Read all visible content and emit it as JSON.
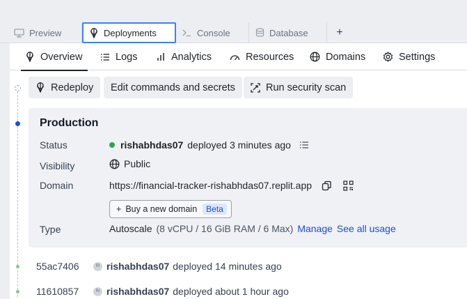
{
  "tabs": [
    {
      "label": "Preview",
      "icon": "monitor-icon",
      "active": false
    },
    {
      "label": "Deployments",
      "icon": "deployments-icon",
      "active": true
    },
    {
      "label": "Console",
      "icon": "terminal-icon",
      "active": false
    },
    {
      "label": "Database",
      "icon": "database-icon",
      "active": false
    }
  ],
  "add_tab_label": "+",
  "subnav": [
    {
      "label": "Overview",
      "icon": "deployments-icon",
      "active": true
    },
    {
      "label": "Logs",
      "icon": "list-icon"
    },
    {
      "label": "Analytics",
      "icon": "bar-chart-icon"
    },
    {
      "label": "Resources",
      "icon": "gauge-icon"
    },
    {
      "label": "Domains",
      "icon": "globe-icon"
    },
    {
      "label": "Settings",
      "icon": "gear-icon"
    }
  ],
  "actions": {
    "redeploy": "Redeploy",
    "edit_commands": "Edit commands and secrets",
    "security_scan": "Run security scan"
  },
  "production": {
    "title": "Production",
    "status_label": "Status",
    "status_user": "rishabhdas07",
    "status_text": "deployed 3 minutes ago",
    "visibility_label": "Visibility",
    "visibility_value": "Public",
    "domain_label": "Domain",
    "domain_url": "https://financial-tracker-rishabhdas07.replit.app",
    "buy_domain": "Buy a new domain",
    "buy_domain_plus": "+",
    "beta_badge": "Beta",
    "type_label": "Type",
    "type_value": "Autoscale",
    "type_specs": "(8 vCPU / 16 GiB RAM / 6 Max)",
    "manage_link": "Manage",
    "usage_link": "See all usage"
  },
  "history": [
    {
      "hash": "55ac7406",
      "avatar": "RI",
      "user": "rishabhdas07",
      "text": "deployed 14 minutes ago"
    },
    {
      "hash": "11610857",
      "avatar": "RI",
      "user": "rishabhdas07",
      "text": "deployed about 1 hour ago"
    }
  ],
  "colors": {
    "accent": "#3b82f6",
    "link": "#1d4ed8",
    "status_green": "#2da44e",
    "card_bg": "#eff1f4"
  }
}
